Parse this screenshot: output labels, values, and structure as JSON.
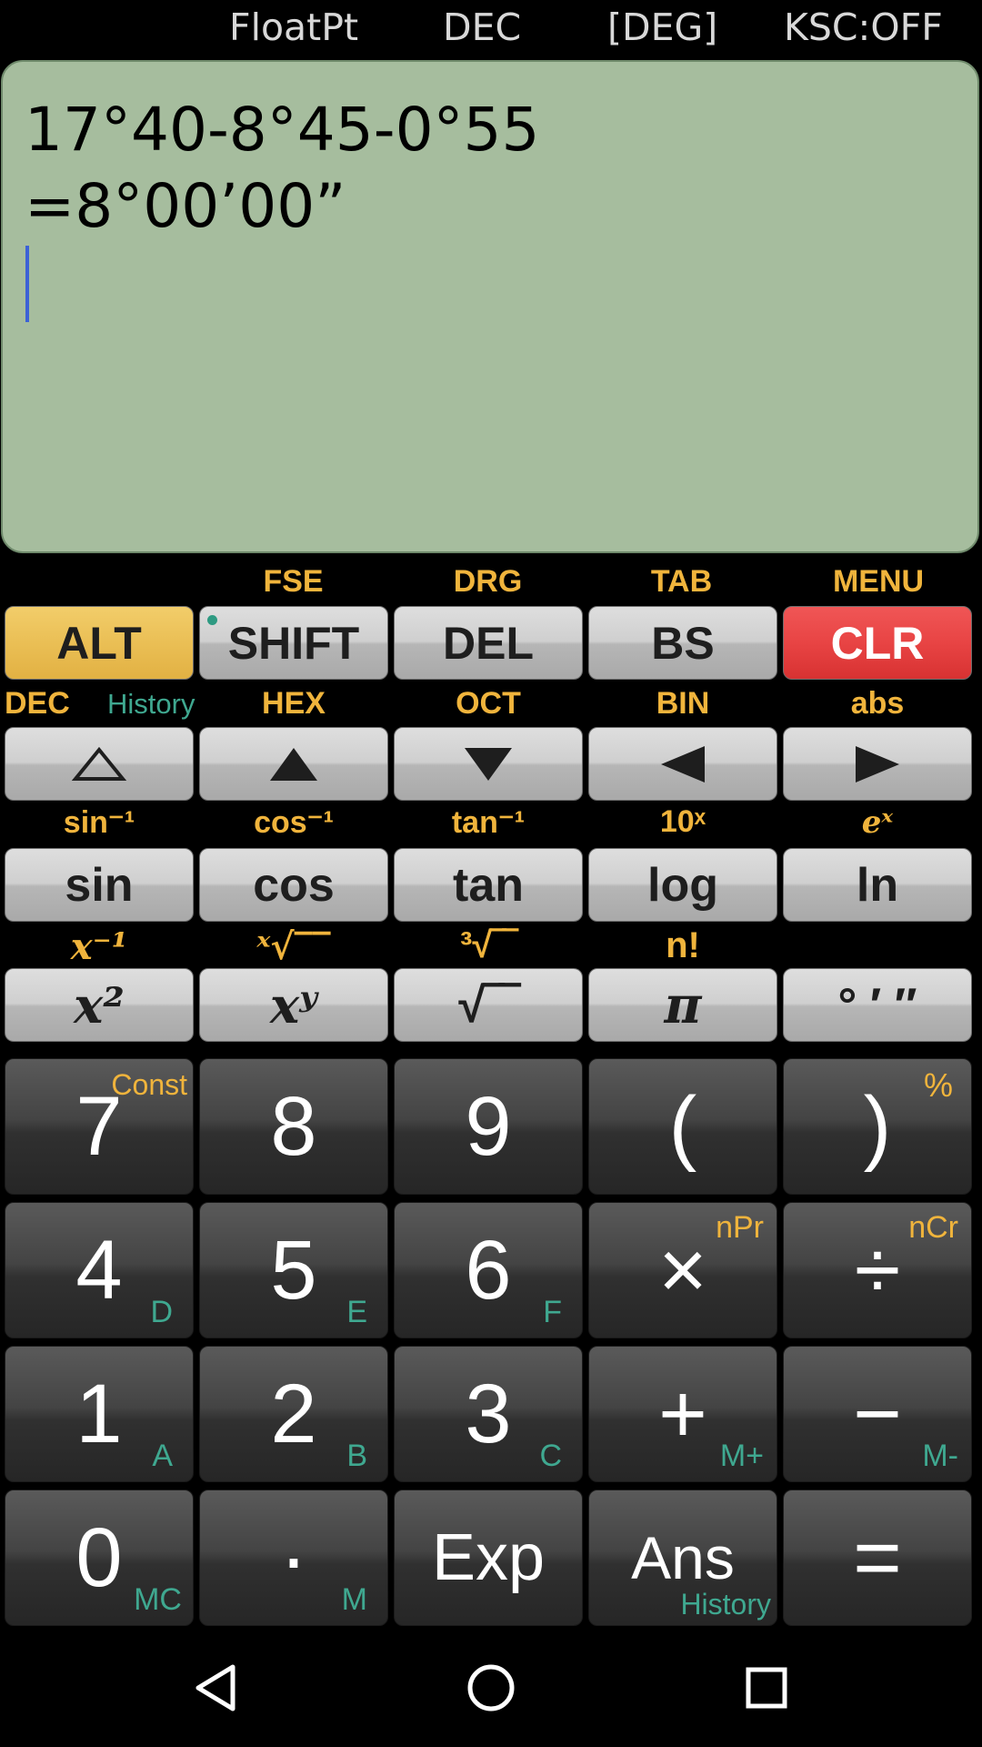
{
  "status": {
    "float_mode": "FloatPt",
    "base_mode": "DEC",
    "angle_mode": "[DEG]",
    "ksc": "KSC:OFF"
  },
  "display": {
    "expression": "17°40-8°45-0°55",
    "result": "=8°00’00”"
  },
  "row1": {
    "labels": [
      "FSE",
      "DRG",
      "TAB",
      "MENU"
    ],
    "keys": [
      "ALT",
      "SHIFT",
      "DEL",
      "BS",
      "CLR"
    ]
  },
  "row2": {
    "labels": [
      "DEC",
      "History",
      "HEX",
      "OCT",
      "BIN",
      "abs"
    ]
  },
  "row3": {
    "labels": [
      "sin⁻¹",
      "cos⁻¹",
      "tan⁻¹",
      "10ˣ",
      "eˣ"
    ],
    "keys": [
      "sin",
      "cos",
      "tan",
      "log",
      "ln"
    ]
  },
  "row4": {
    "labels": [
      "x⁻¹",
      "ˣ√‾‾",
      "³√‾‾",
      "n!"
    ],
    "keys": [
      "x²",
      "xʸ",
      "√‾‾",
      "π",
      "° ′ ″"
    ]
  },
  "numpad": {
    "k7": "7",
    "k7_sup": "Const",
    "k8": "8",
    "k9": "9",
    "lparen": "(",
    "rparen": ")",
    "rparen_sup": "%",
    "k4": "4",
    "k4_sub": "D",
    "k5": "5",
    "k5_sub": "E",
    "k6": "6",
    "k6_sub": "F",
    "mul": "×",
    "mul_sup": "nPr",
    "div": "÷",
    "div_sup": "nCr",
    "k1": "1",
    "k1_sub": "A",
    "k2": "2",
    "k2_sub": "B",
    "k3": "3",
    "k3_sub": "C",
    "plus": "+",
    "plus_sub": "M+",
    "minus": "−",
    "minus_sub": "M-",
    "k0": "0",
    "k0_sub": "MC",
    "dot": "·",
    "dot_sub": "M",
    "exp": "Exp",
    "ans": "Ans",
    "ans_sub": "History",
    "equals": "="
  },
  "colors": {
    "display_bg": "#a6bd9e",
    "alt_key": "#eabf55",
    "clr_key": "#e84444",
    "shift_label": "#f0b43c",
    "hex_label": "#3fa890"
  },
  "navbar": {
    "icons": [
      "back-icon",
      "home-icon",
      "recents-icon"
    ]
  }
}
